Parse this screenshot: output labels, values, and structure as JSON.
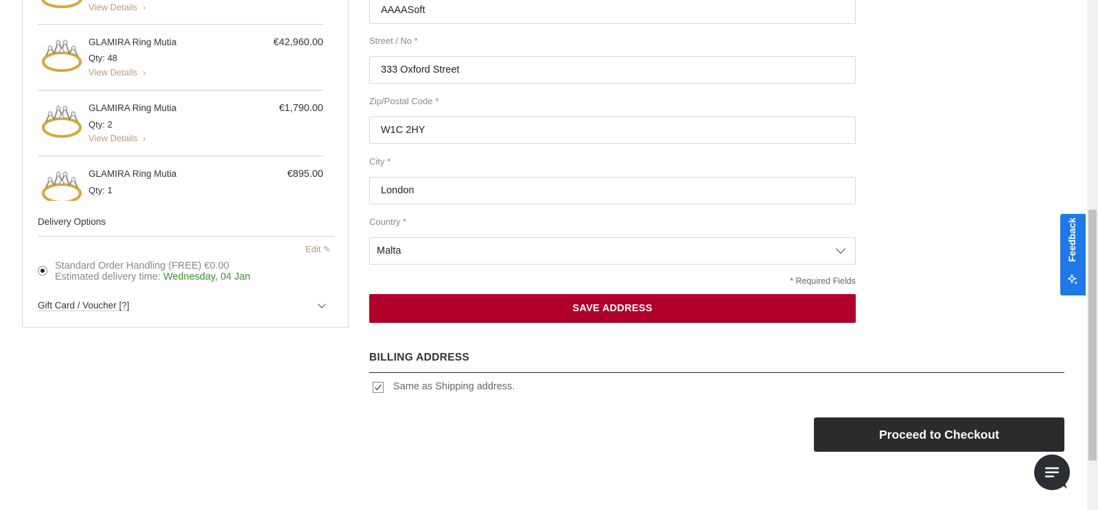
{
  "order_items": [
    {
      "name": "",
      "qty": "",
      "price": "",
      "details_label": "View Details"
    },
    {
      "name": "GLAMIRA Ring Mutia",
      "qty": "Qty: 48",
      "price": "€42,960.00",
      "details_label": "View Details"
    },
    {
      "name": "GLAMIRA Ring Mutia",
      "qty": "Qty: 2",
      "price": "€1,790.00",
      "details_label": "View Details"
    },
    {
      "name": "GLAMIRA Ring Mutia",
      "qty": "Qty: 1",
      "price": "€895.00",
      "details_label": ""
    }
  ],
  "delivery": {
    "title": "Delivery Options",
    "edit_label": "Edit",
    "option_text": "Standard Order Handling (FREE) €0.00",
    "estimate_label": "Estimated delivery time:",
    "estimate_date": "Wednesday, 04 Jan",
    "estimate_color": "#3a8f2e"
  },
  "gift": {
    "label": "Gift Card / Voucher [?]"
  },
  "form": {
    "company_value": "AAAASoft",
    "street": {
      "label": "Street / No  *",
      "value": "333 Oxford Street"
    },
    "zip": {
      "label": "Zip/Postal Code *",
      "value": "W1C 2HY"
    },
    "city": {
      "label": "City *",
      "value": "London"
    },
    "country": {
      "label": "Country *",
      "value": "Malta"
    },
    "required_note": "* Required Fields",
    "save_label": "SAVE ADDRESS"
  },
  "billing": {
    "title": "BILLING ADDRESS",
    "same_label": "Same as Shipping address.",
    "same_checked": true
  },
  "checkout_label": "Proceed to Checkout",
  "feedback_label": "Feedback",
  "colors": {
    "primary_button": "#b0002a",
    "checkout_button": "#2b2b2b",
    "feedback_tab": "#1f7ae8",
    "link": "#b99a7a"
  }
}
